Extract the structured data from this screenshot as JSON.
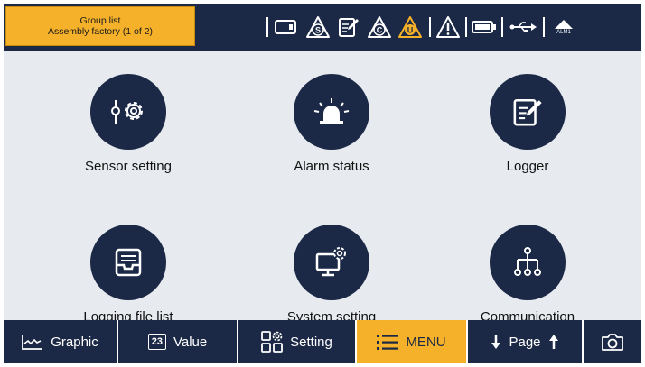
{
  "header": {
    "group_title": "Group list",
    "group_subtitle": "Assembly factory (1 of 2)",
    "status_icons": [
      "sd-card-icon",
      "s-alarm-warning-icon",
      "logger-edit-icon",
      "c-alarm-warning-icon",
      "u-alarm-warning-icon",
      "general-warning-icon",
      "battery-icon",
      "usb-icon"
    ],
    "alm_label": "ALM1"
  },
  "menu": {
    "items": [
      {
        "label": "Sensor setting",
        "icon": "sensor-settings-icon"
      },
      {
        "label": "Alarm status",
        "icon": "alarm-beacon-icon"
      },
      {
        "label": "Logger",
        "icon": "logger-edit-icon"
      },
      {
        "label": "Logging file list",
        "icon": "file-tray-icon"
      },
      {
        "label": "System setting",
        "icon": "monitor-gear-icon"
      },
      {
        "label": "Communication",
        "icon": "network-tree-icon"
      }
    ]
  },
  "bottom_bar": {
    "tabs": [
      {
        "label": "Graphic",
        "icon": "graph-line-icon"
      },
      {
        "label": "Value",
        "icon": "value-23-icon",
        "icon_text": "23"
      },
      {
        "label": "Setting",
        "icon": "settings-grid-icon"
      },
      {
        "label": "MENU",
        "icon": "menu-list-icon",
        "active": true
      },
      {
        "label": "Page",
        "icon": "page-arrows-icon"
      },
      {
        "label": "",
        "icon": "camera-icon"
      }
    ]
  },
  "colors": {
    "navy": "#1b2846",
    "accent": "#f5b129",
    "background": "#e7eaee"
  }
}
